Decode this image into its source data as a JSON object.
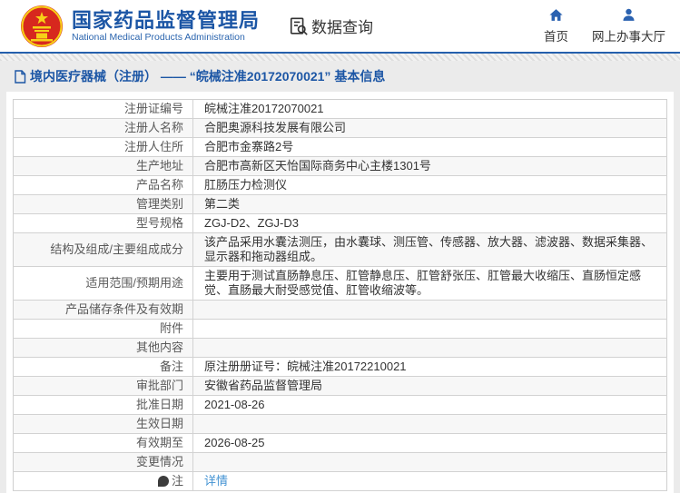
{
  "header": {
    "agency_cn": "国家药品监督管理局",
    "agency_en": "National Medical Products Administration",
    "data_query_label": "数据查询",
    "nav": {
      "home": "首页",
      "online_hall": "网上办事大厅"
    }
  },
  "breadcrumb": {
    "text": "境内医疗器械（注册） —— “皖械注准20172070021” 基本信息"
  },
  "colors": {
    "brand_blue": "#1c56a5",
    "divider_blue": "#2560ad",
    "link_blue": "#4393d3",
    "row_stripe": "#f7f7f7",
    "emblem_red": "#d7281e",
    "emblem_gold": "#f7d117"
  },
  "table": {
    "rows": [
      {
        "label": "注册证编号",
        "value": "皖械注准20172070021"
      },
      {
        "label": "注册人名称",
        "value": "合肥奥源科技发展有限公司"
      },
      {
        "label": "注册人住所",
        "value": "合肥市金寨路2号"
      },
      {
        "label": "生产地址",
        "value": "合肥市高新区天怡国际商务中心主楼1301号"
      },
      {
        "label": "产品名称",
        "value": "肛肠压力检测仪"
      },
      {
        "label": "管理类别",
        "value": "第二类"
      },
      {
        "label": "型号规格",
        "value": "ZGJ-D2、ZGJ-D3"
      },
      {
        "label": "结构及组成/主要组成成分",
        "value": "该产品采用水囊法测压，由水囊球、测压管、传感器、放大器、滤波器、数据采集器、显示器和拖动器组成。"
      },
      {
        "label": "适用范围/预期用途",
        "value": "主要用于测试直肠静息压、肛管静息压、肛管舒张压、肛管最大收缩压、直肠恒定感觉、直肠最大耐受感觉值、肛管收缩波等。"
      },
      {
        "label": "产品储存条件及有效期",
        "value": ""
      },
      {
        "label": "附件",
        "value": ""
      },
      {
        "label": "其他内容",
        "value": ""
      },
      {
        "label": "备注",
        "value": "原注册册证号：皖械注准20172210021"
      },
      {
        "label": "审批部门",
        "value": "安徽省药品监督管理局"
      },
      {
        "label": "批准日期",
        "value": "2021-08-26"
      },
      {
        "label": "生效日期",
        "value": ""
      },
      {
        "label": "有效期至",
        "value": "2026-08-25"
      },
      {
        "label": "变更情况",
        "value": ""
      },
      {
        "label": "注",
        "value": "详情",
        "link": true,
        "icon": "note"
      }
    ]
  }
}
